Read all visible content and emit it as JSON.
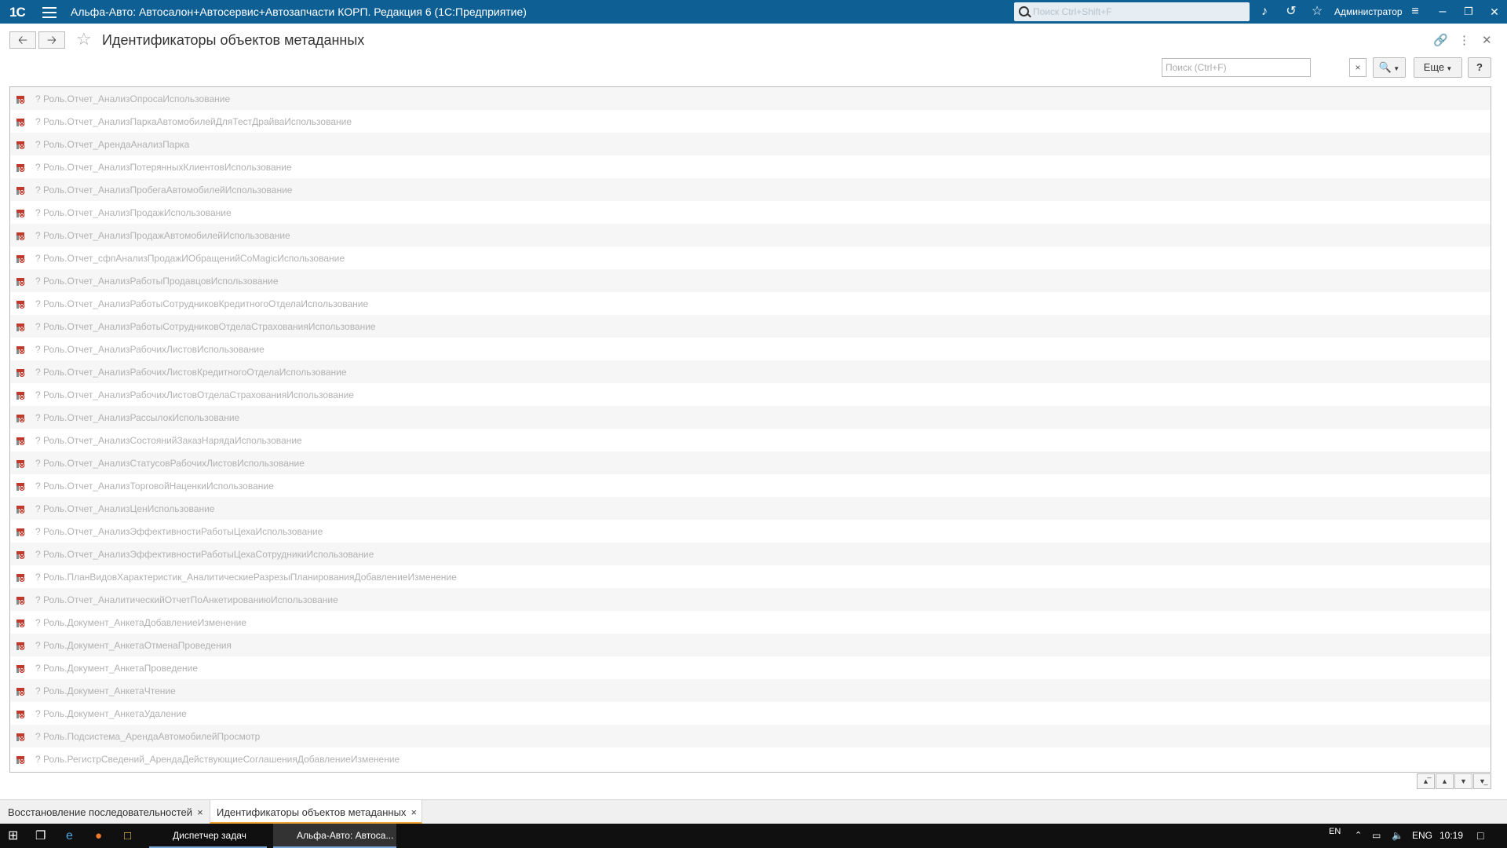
{
  "titlebar": {
    "logo": "1С",
    "app_title": "Альфа-Авто: Автосалон+Автосервис+Автозапчасти КОРП. Редакция 6  (1С:Предприятие)",
    "search_placeholder": "Поиск Ctrl+Shift+F",
    "user": "Администратор"
  },
  "form": {
    "title": "Идентификаторы объектов метаданных"
  },
  "toolbar": {
    "search_placeholder": "Поиск (Ctrl+F)",
    "clear_label": "×",
    "more_label": "Еще",
    "help_label": "?"
  },
  "rows": [
    "? Роль.Отчет_АнализОпросаИспользование",
    "? Роль.Отчет_АнализПаркаАвтомобилейДляТестДрайваИспользование",
    "? Роль.Отчет_АрендаАнализПарка",
    "? Роль.Отчет_АнализПотерянныхКлиентовИспользование",
    "? Роль.Отчет_АнализПробегаАвтомобилейИспользование",
    "? Роль.Отчет_АнализПродажИспользование",
    "? Роль.Отчет_АнализПродажАвтомобилейИспользование",
    "? Роль.Отчет_сфпАнализПродажИОбращенийCoMagicИспользование",
    "? Роль.Отчет_АнализРаботыПродавцовИспользование",
    "? Роль.Отчет_АнализРаботыСотрудниковКредитногоОтделаИспользование",
    "? Роль.Отчет_АнализРаботыСотрудниковОтделаСтрахованияИспользование",
    "? Роль.Отчет_АнализРабочихЛистовИспользование",
    "? Роль.Отчет_АнализРабочихЛистовКредитногоОтделаИспользование",
    "? Роль.Отчет_АнализРабочихЛистовОтделаСтрахованияИспользование",
    "? Роль.Отчет_АнализРассылокИспользование",
    "? Роль.Отчет_АнализСостоянийЗаказНарядаИспользование",
    "? Роль.Отчет_АнализСтатусовРабочихЛистовИспользование",
    "? Роль.Отчет_АнализТорговойНаценкиИспользование",
    "? Роль.Отчет_АнализЦенИспользование",
    "? Роль.Отчет_АнализЭффективностиРаботыЦехаИспользование",
    "? Роль.Отчет_АнализЭффективностиРаботыЦехаСотрудникиИспользование",
    "? Роль.ПланВидовХарактеристик_АналитическиеРазрезыПланированияДобавлениеИзменение",
    "? Роль.Отчет_АналитическийОтчетПоАнкетированиюИспользование",
    "? Роль.Документ_АнкетаДобавлениеИзменение",
    "? Роль.Документ_АнкетаОтменаПроведения",
    "? Роль.Документ_АнкетаПроведение",
    "? Роль.Документ_АнкетаЧтение",
    "? Роль.Документ_АнкетаУдаление",
    "? Роль.Подсистема_АрендаАвтомобилейПросмотр",
    "? Роль.РегистрСведений_АрендаДействующиеСоглашенияДобавлениеИзменение"
  ],
  "row_icon": "delete-mark-icon",
  "tabs": [
    {
      "label": "Восстановление последовательностей",
      "close": "×"
    },
    {
      "label": "Идентификаторы объектов метаданных",
      "close": "×"
    }
  ],
  "taskbar": {
    "app1": "Диспетчер задач",
    "app2": "Альфа-Авто: Автоса...",
    "lang_indicator": "EN",
    "lang": "ENG",
    "time": "10:19"
  },
  "colors": {
    "titlebar": "#0e5f94",
    "row_text": "#b1b1b1",
    "active_tab_accent": "#f0a630",
    "delete_icon": "#c0392b"
  }
}
